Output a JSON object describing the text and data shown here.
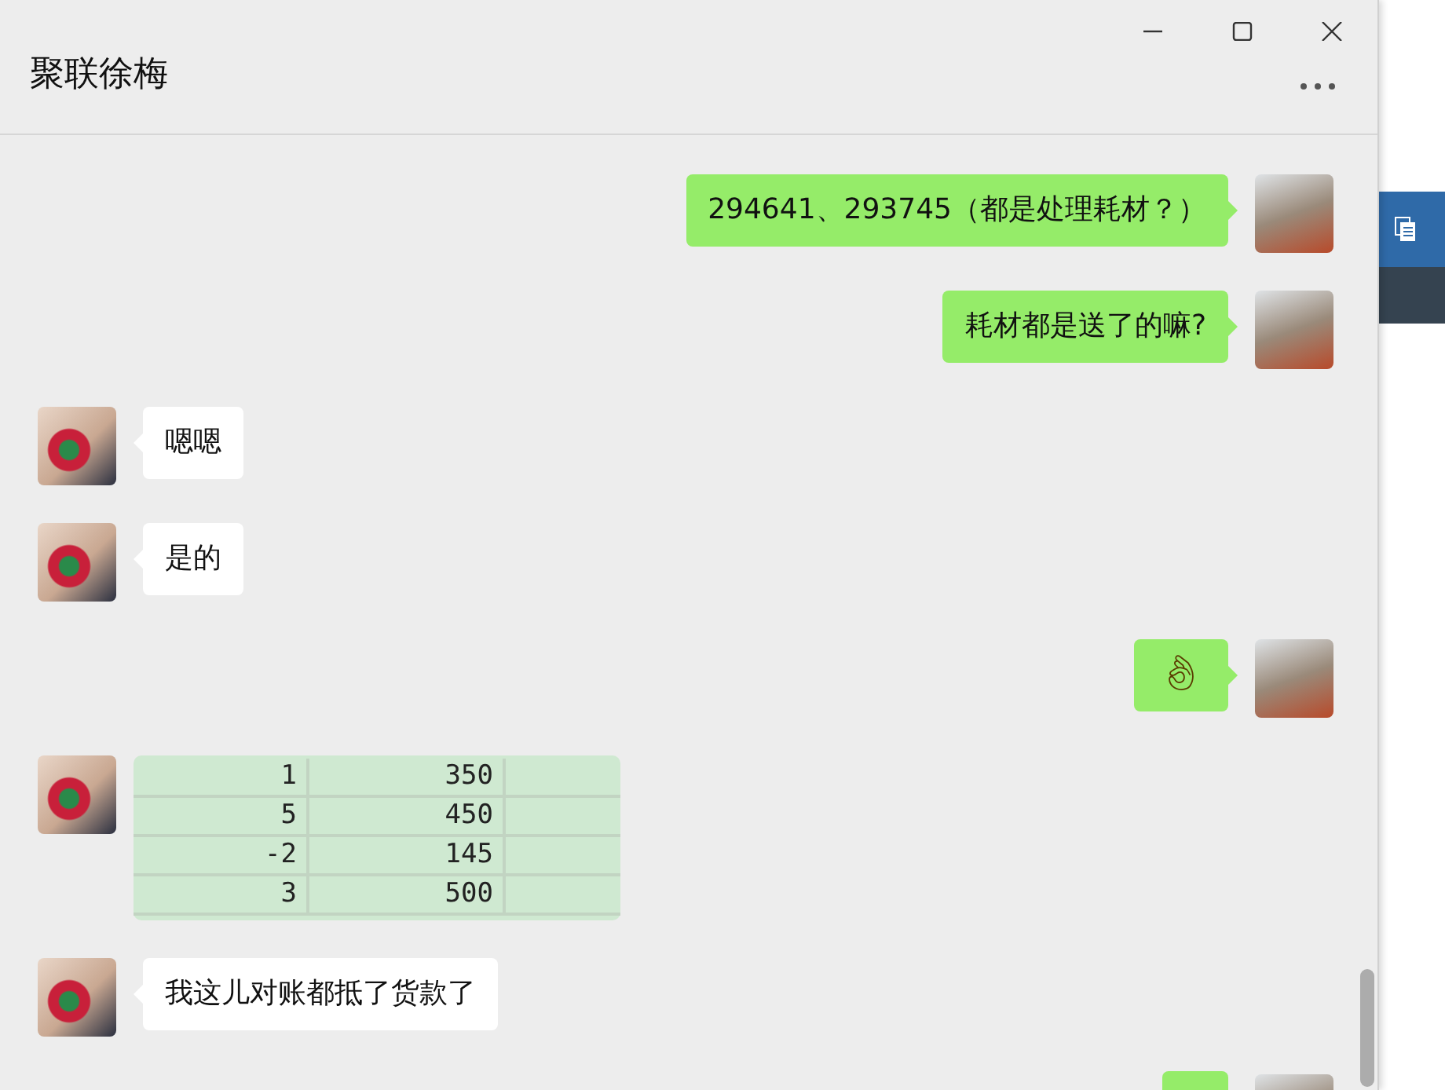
{
  "window": {
    "title": "聚联徐梅"
  },
  "messages": [
    {
      "outgoing": true,
      "kind": "text",
      "text": "294641、293745（都是处理耗材？）"
    },
    {
      "outgoing": true,
      "kind": "text",
      "text": "耗材都是送了的嘛?"
    },
    {
      "outgoing": false,
      "kind": "text",
      "text": "嗯嗯"
    },
    {
      "outgoing": false,
      "kind": "text",
      "text": "是的"
    },
    {
      "outgoing": true,
      "kind": "emoji",
      "text": "👌"
    },
    {
      "outgoing": false,
      "kind": "sheet",
      "rows": [
        [
          "1",
          "350"
        ],
        [
          "5",
          "450"
        ],
        [
          "-2",
          "145"
        ],
        [
          "3",
          "500"
        ]
      ]
    },
    {
      "outgoing": false,
      "kind": "text",
      "text": "我这儿对账都抵了货款了"
    },
    {
      "outgoing": true,
      "kind": "cut"
    }
  ]
}
